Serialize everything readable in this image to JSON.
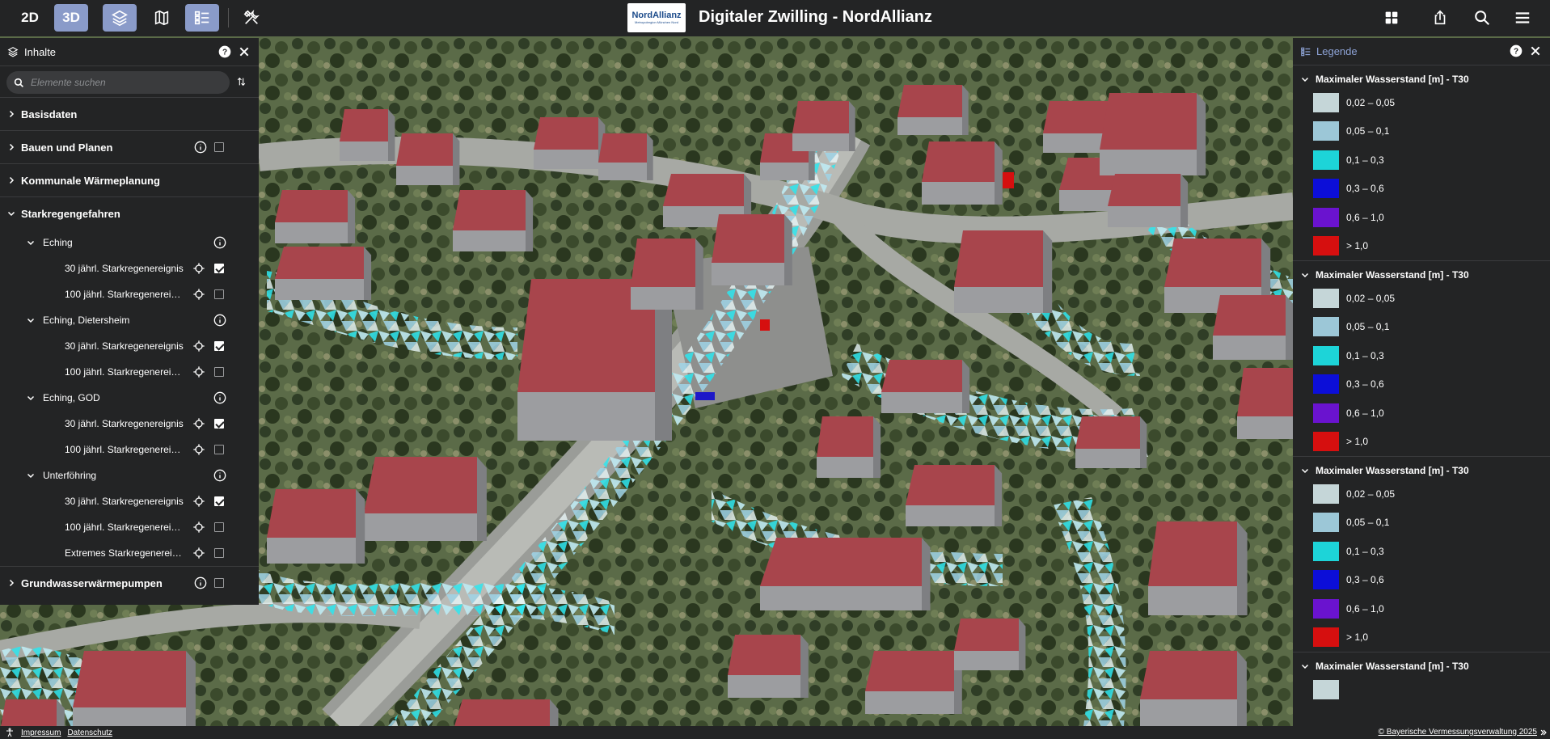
{
  "topbar": {
    "btn_2d": "2D",
    "btn_3d": "3D",
    "logo_text": "NordAllianz",
    "logo_sub": "Metropolregion München Nord",
    "title": "Digitaler Zwilling - NordAllianz",
    "accent_color": "#8a9bc9"
  },
  "contents": {
    "title": "Inhalte",
    "search_placeholder": "Elemente suchen",
    "basisdaten": "Basisdaten",
    "bauen": "Bauen und Planen",
    "waerme": "Kommunale Wärmeplanung",
    "starkregen": "Starkregengefahren",
    "eching": "Eching",
    "eching_30": "30 jährl. Starkregenereignis",
    "eching_100": "100 jährl. Starkregenereignis",
    "dietersheim": "Eching, Dietersheim",
    "dietersheim_30": "30 jährl. Starkregenereignis",
    "dietersheim_100": "100 jährl. Starkregenereignis",
    "god": "Eching, GOD",
    "god_30": "30 jährl. Starkregenereignis",
    "god_100": "100 jährl. Starkregenereignis",
    "unterfoehring": "Unterföhring",
    "unter_30": "30 jährl. Starkregenereignis",
    "unter_100": "100 jährl. Starkregenereignis",
    "unter_ext": "Extremes Starkregenereignis",
    "grundwasser": "Grundwasserwärmepumpen"
  },
  "legend": {
    "title": "Legende",
    "section_title": "Maximaler Wasserstand [m] - T30",
    "items": [
      {
        "label": "0,02 – 0,05",
        "color": "#c5d6d8"
      },
      {
        "label": "0,05 – 0,1",
        "color": "#9cc7d7"
      },
      {
        "label": "0,1 – 0,3",
        "color": "#1dd4d8"
      },
      {
        "label": "0,3 – 0,6",
        "color": "#0c0ed8"
      },
      {
        "label": "0,6 – 1,0",
        "color": "#6a13cf"
      },
      {
        "label": "> 1,0",
        "color": "#d60f0f"
      }
    ]
  },
  "footer": {
    "impressum": "Impressum",
    "datenschutz": "Datenschutz",
    "copyright": "© Bayerische Vermessungsverwaltung 2025"
  }
}
